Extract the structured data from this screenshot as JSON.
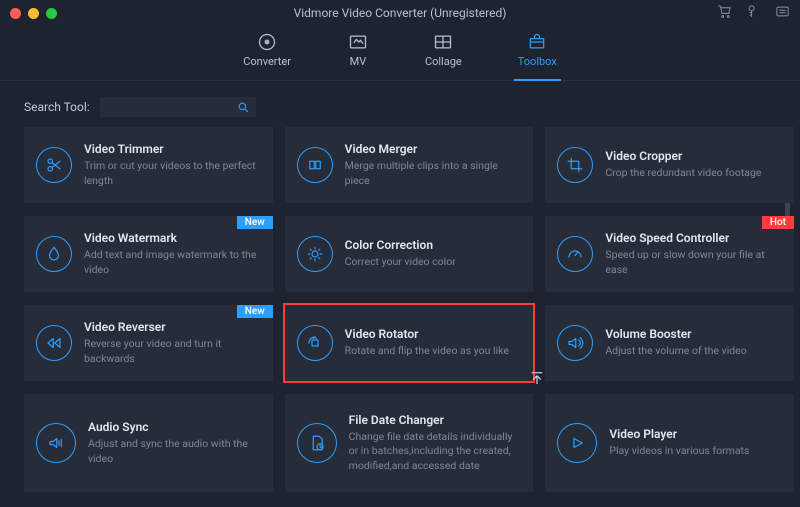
{
  "window": {
    "title": "Vidmore Video Converter (Unregistered)"
  },
  "tabs": [
    {
      "label": "Converter"
    },
    {
      "label": "MV"
    },
    {
      "label": "Collage"
    },
    {
      "label": "Toolbox"
    }
  ],
  "search": {
    "label": "Search Tool:",
    "placeholder": ""
  },
  "badges": {
    "new": "New",
    "hot": "Hot"
  },
  "tools": [
    {
      "title": "Video Trimmer",
      "desc": "Trim or cut your videos to the perfect length"
    },
    {
      "title": "Video Merger",
      "desc": "Merge multiple clips into a single piece"
    },
    {
      "title": "Video Cropper",
      "desc": "Crop the redundant video footage"
    },
    {
      "title": "Video Watermark",
      "desc": "Add text and image watermark to the video"
    },
    {
      "title": "Color Correction",
      "desc": "Correct your video color"
    },
    {
      "title": "Video Speed Controller",
      "desc": "Speed up or slow down your file at ease"
    },
    {
      "title": "Video Reverser",
      "desc": "Reverse your video and turn it backwards"
    },
    {
      "title": "Video Rotator",
      "desc": "Rotate and flip the video as you like"
    },
    {
      "title": "Volume Booster",
      "desc": "Adjust the volume of the video"
    },
    {
      "title": "Audio Sync",
      "desc": "Adjust and sync the audio with the video"
    },
    {
      "title": "File Date Changer",
      "desc": "Change file date details individually or in batches,including the created, modified,and accessed date"
    },
    {
      "title": "Video Player",
      "desc": "Play videos in various formats"
    }
  ]
}
